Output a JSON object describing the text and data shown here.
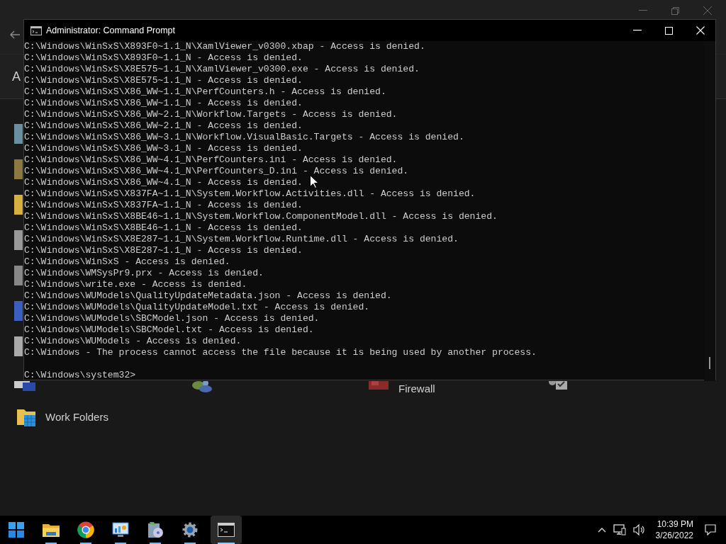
{
  "background_window": {
    "heading": "A",
    "items": [
      {
        "kind": "troubleshooting"
      },
      {
        "kind": "users"
      },
      {
        "kind": "firewall",
        "label": "Firewall"
      },
      {
        "kind": "tools"
      },
      {
        "kind": "folders",
        "label": "Work Folders"
      }
    ]
  },
  "console": {
    "title": "Administrator: Command Prompt",
    "lines": [
      "C:\\Windows\\WinSxS\\X893F0~1.1_N\\XamlViewer_v0300.xbap - Access is denied.",
      "C:\\Windows\\WinSxS\\X893F0~1.1_N - Access is denied.",
      "C:\\Windows\\WinSxS\\X8E575~1.1_N\\XamlViewer_v0300.exe - Access is denied.",
      "C:\\Windows\\WinSxS\\X8E575~1.1_N - Access is denied.",
      "C:\\Windows\\WinSxS\\X86_WW~1.1_N\\PerfCounters.h - Access is denied.",
      "C:\\Windows\\WinSxS\\X86_WW~1.1_N - Access is denied.",
      "C:\\Windows\\WinSxS\\X86_WW~2.1_N\\Workflow.Targets - Access is denied.",
      "C:\\Windows\\WinSxS\\X86_WW~2.1_N - Access is denied.",
      "C:\\Windows\\WinSxS\\X86_WW~3.1_N\\Workflow.VisualBasic.Targets - Access is denied.",
      "C:\\Windows\\WinSxS\\X86_WW~3.1_N - Access is denied.",
      "C:\\Windows\\WinSxS\\X86_WW~4.1_N\\PerfCounters.ini - Access is denied.",
      "C:\\Windows\\WinSxS\\X86_WW~4.1_N\\PerfCounters_D.ini - Access is denied.",
      "C:\\Windows\\WinSxS\\X86_WW~4.1_N - Access is denied.",
      "C:\\Windows\\WinSxS\\X837FA~1.1_N\\System.Workflow.Activities.dll - Access is denied.",
      "C:\\Windows\\WinSxS\\X837FA~1.1_N - Access is denied.",
      "C:\\Windows\\WinSxS\\X8BE46~1.1_N\\System.Workflow.ComponentModel.dll - Access is denied.",
      "C:\\Windows\\WinSxS\\X8BE46~1.1_N - Access is denied.",
      "C:\\Windows\\WinSxS\\X8E287~1.1_N\\System.Workflow.Runtime.dll - Access is denied.",
      "C:\\Windows\\WinSxS\\X8E287~1.1_N - Access is denied.",
      "C:\\Windows\\WinSxS - Access is denied.",
      "C:\\Windows\\WMSysPr9.prx - Access is denied.",
      "C:\\Windows\\write.exe - Access is denied.",
      "C:\\Windows\\WUModels\\QualityUpdateMetadata.json - Access is denied.",
      "C:\\Windows\\WUModels\\QualityUpdateModel.txt - Access is denied.",
      "C:\\Windows\\WUModels\\SBCModel.json - Access is denied.",
      "C:\\Windows\\WUModels\\SBCModel.txt - Access is denied.",
      "C:\\Windows\\WUModels - Access is denied.",
      "C:\\Windows - The process cannot access the file because it is being used by another process."
    ],
    "prompt": "C:\\Windows\\system32>"
  },
  "taskbar": {
    "apps": [
      {
        "kind": "start",
        "running": false,
        "selected": false
      },
      {
        "kind": "explorer",
        "running": true,
        "selected": false
      },
      {
        "kind": "browser",
        "running": true,
        "selected": false
      },
      {
        "kind": "monitor",
        "running": true,
        "selected": false
      },
      {
        "kind": "installer",
        "running": true,
        "selected": false
      },
      {
        "kind": "settings",
        "running": true,
        "selected": false
      },
      {
        "kind": "terminal",
        "running": true,
        "selected": true
      }
    ],
    "time": "10:39 PM",
    "date": "3/26/2022"
  }
}
